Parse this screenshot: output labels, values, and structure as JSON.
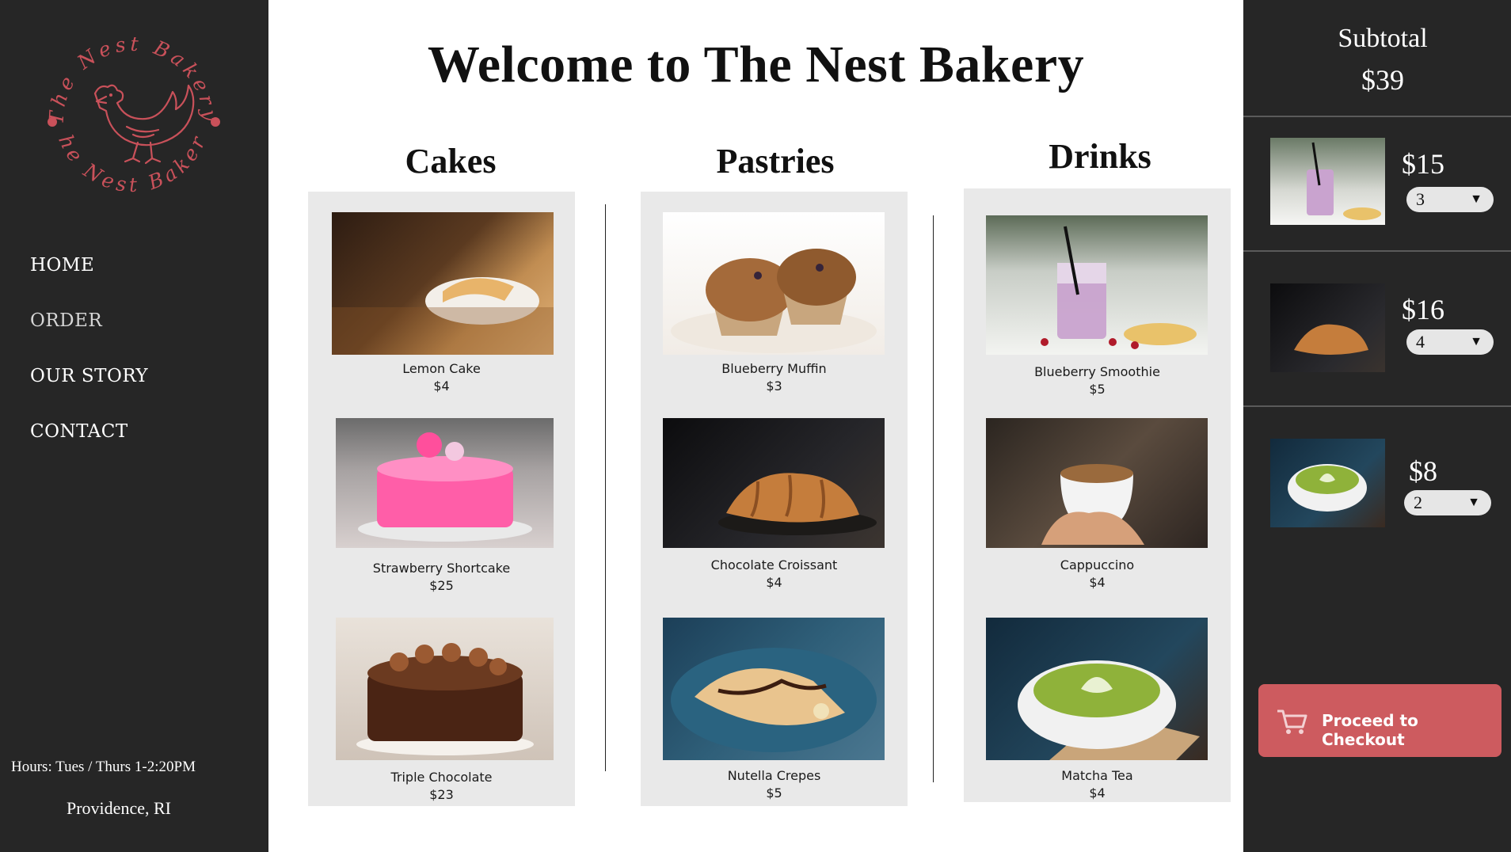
{
  "brand": {
    "logo_text_top": "The Nest Bakery",
    "logo_text_bottom": "The Nest Bakery",
    "logo_color": "#c9515a"
  },
  "nav": {
    "items": [
      {
        "label": "HOME"
      },
      {
        "label": "ORDER"
      },
      {
        "label": "OUR STORY"
      },
      {
        "label": "CONTACT"
      }
    ]
  },
  "footer": {
    "hours": "Hours: Tues / Thurs 1-2:20PM",
    "location": "Providence, RI"
  },
  "main": {
    "title": "Welcome to The Nest Bakery",
    "categories": [
      {
        "title": "Cakes",
        "items": [
          {
            "name": "Lemon Cake",
            "price": "$4",
            "icon": "lemon-cake-photo"
          },
          {
            "name": "Strawberry Shortcake",
            "price": "$25",
            "icon": "strawberry-shortcake-photo"
          },
          {
            "name": "Triple Chocolate",
            "price": "$23",
            "icon": "triple-chocolate-photo"
          }
        ]
      },
      {
        "title": "Pastries",
        "items": [
          {
            "name": "Blueberry Muffin",
            "price": "$3",
            "icon": "blueberry-muffin-photo"
          },
          {
            "name": "Chocolate Croissant",
            "price": "$4",
            "icon": "chocolate-croissant-photo"
          },
          {
            "name": "Nutella Crepes",
            "price": "$5",
            "icon": "nutella-crepes-photo"
          }
        ]
      },
      {
        "title": "Drinks",
        "items": [
          {
            "name": "Blueberry Smoothie",
            "price": "$5",
            "icon": "blueberry-smoothie-photo"
          },
          {
            "name": "Cappuccino",
            "price": "$4",
            "icon": "cappuccino-photo"
          },
          {
            "name": "Matcha Tea",
            "price": "$4",
            "icon": "matcha-tea-photo"
          }
        ]
      }
    ]
  },
  "cart": {
    "subtotal_label": "Subtotal",
    "subtotal_value": "$39",
    "items": [
      {
        "price": "$15",
        "qty": "3",
        "icon": "blueberry-smoothie-thumb"
      },
      {
        "price": "$16",
        "qty": "4",
        "icon": "chocolate-croissant-thumb"
      },
      {
        "price": "$8",
        "qty": "2",
        "icon": "matcha-tea-thumb"
      }
    ],
    "checkout_label": "Proceed to Checkout",
    "checkout_color": "#cd5b5f"
  }
}
